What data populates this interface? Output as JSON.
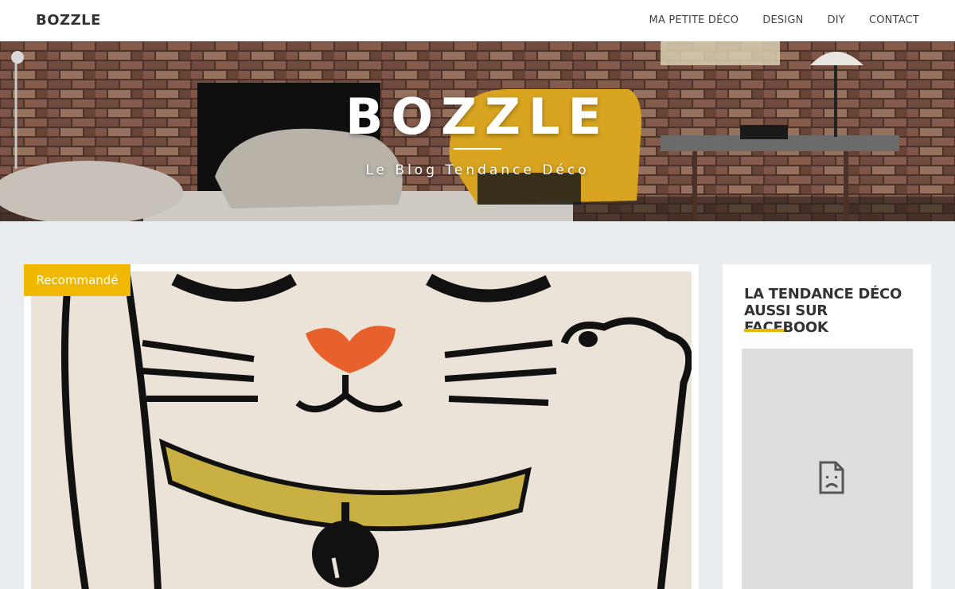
{
  "site": {
    "brand": "BOZZLE"
  },
  "nav": {
    "items": [
      {
        "label": "MA PETITE DÉCO"
      },
      {
        "label": "DESIGN"
      },
      {
        "label": "DIY"
      },
      {
        "label": "CONTACT"
      }
    ]
  },
  "hero": {
    "title": "BOZZLE",
    "subtitle": "Le Blog Tendance Déco"
  },
  "featured_post": {
    "badge": "Recommandé"
  },
  "sidebar": {
    "widget_title": "LA TENDANCE DÉCO AUSSI SUR FACEBOOK",
    "embed_status_icon": "broken-page-icon"
  },
  "colors": {
    "accent": "#f0b800",
    "background": "#e9edf0",
    "text": "#333333"
  }
}
